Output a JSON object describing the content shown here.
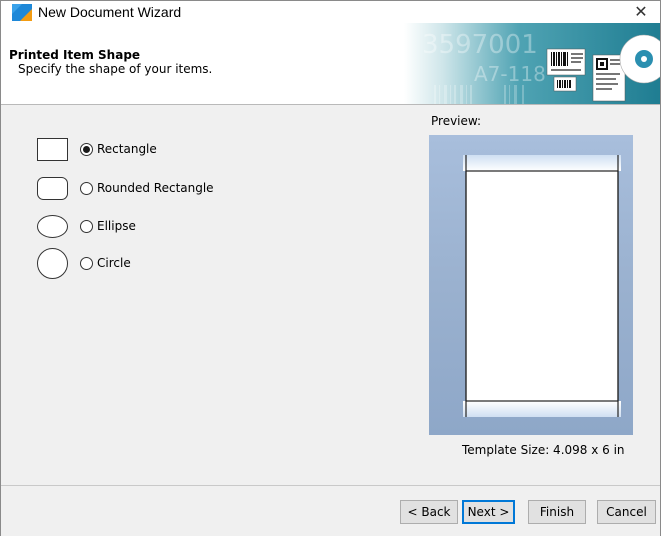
{
  "window": {
    "title": "New Document Wizard",
    "close_glyph": "✕"
  },
  "header": {
    "title": "Printed Item Shape",
    "subtitle": "Specify the shape of your items.",
    "banner": {
      "big_number": "3597001",
      "code": "A7-118",
      "icon": "barcode-labels-banner"
    }
  },
  "shapes": [
    {
      "label": "Rectangle",
      "icon": "rectangle-shape-icon",
      "selected": true
    },
    {
      "label": "Rounded Rectangle",
      "icon": "rounded-rectangle-shape-icon",
      "selected": false
    },
    {
      "label": "Ellipse",
      "icon": "ellipse-shape-icon",
      "selected": false
    },
    {
      "label": "Circle",
      "icon": "circle-shape-icon",
      "selected": false
    }
  ],
  "preview": {
    "label": "Preview:",
    "template_size": "Template Size:  4.098 x 6 in",
    "background_color": "#9fb6d4"
  },
  "buttons": {
    "back": "< Back",
    "next": "Next >",
    "finish": "Finish",
    "cancel": "Cancel"
  },
  "colors": {
    "accent": "#0078d7",
    "window_bg": "#f0f0f0"
  }
}
